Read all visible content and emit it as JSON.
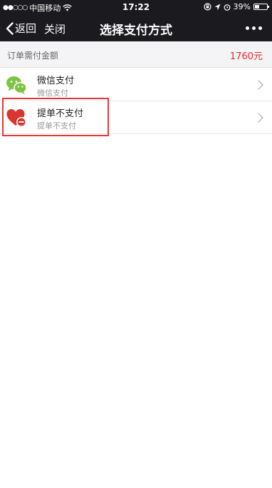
{
  "status_bar": {
    "signal_dots": "●●○○○",
    "carrier": "中国移动",
    "time": "17:22",
    "battery_percent": "39%",
    "battery_level": 0.39
  },
  "nav": {
    "back_label": "返回",
    "close_label": "关闭",
    "title": "选择支付方式"
  },
  "order": {
    "label": "订单需付金额",
    "amount": "1760元"
  },
  "payment_methods": [
    {
      "title": "微信支付",
      "subtitle": "微信支付",
      "icon": "wechat-icon"
    },
    {
      "title": "提单不支付",
      "subtitle": "提单不支付",
      "icon": "heart-minus-icon"
    }
  ],
  "colors": {
    "bar_bg": "#1b1b1f",
    "accent_red": "#e02b2b",
    "wechat_green": "#7cc443",
    "heart_red": "#d9362f"
  }
}
